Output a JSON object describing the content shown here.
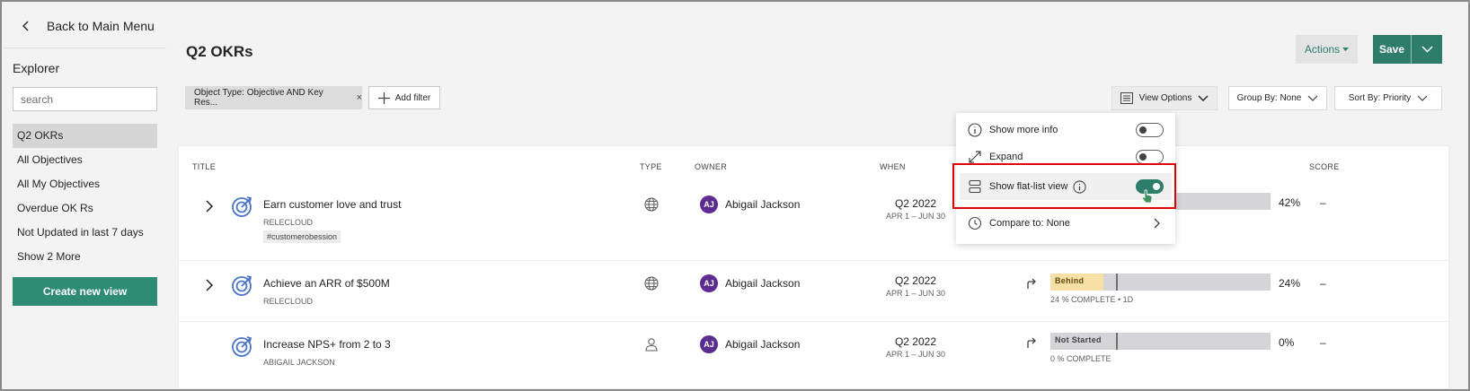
{
  "sidebar": {
    "back_label": "Back to Main Menu",
    "explorer_title": "Explorer",
    "search_placeholder": "search",
    "items": [
      {
        "label": "Q2 OKRs",
        "active": true
      },
      {
        "label": "All Objectives",
        "active": false
      },
      {
        "label": "All My Objectives",
        "active": false
      },
      {
        "label": "Overdue OK Rs",
        "active": false
      },
      {
        "label": "Not Updated in last 7 days",
        "active": false
      },
      {
        "label": "Show 2 More",
        "active": false
      }
    ],
    "create_view_label": "Create new view"
  },
  "header": {
    "title": "Q2 OKRs",
    "actions_label": "Actions",
    "save_label": "Save"
  },
  "filters": {
    "chip_label": "Object Type: Objective AND Key Res...",
    "chip_close": "×",
    "add_filter_label": "Add filter"
  },
  "controls": {
    "view_options": "View Options",
    "group_by": "Group By: None",
    "sort_by": "Sort By: Priority"
  },
  "table": {
    "headers": {
      "title": "TITLE",
      "type": "TYPE",
      "owner": "OWNER",
      "when": "WHEN",
      "score": "SCORE"
    },
    "rows": [
      {
        "title": "Earn customer love and trust",
        "subtitle": "RELECLOUD",
        "tag": "#customerobession",
        "type_icon": "globe-icon",
        "owner_initials": "AJ",
        "owner": "Abigail Jackson",
        "quarter": "Q2 2022",
        "range": "APR 1 – JUN 30",
        "progress": 0.42,
        "percent": "42%",
        "score": "–"
      },
      {
        "title": "Achieve an ARR of $500M",
        "subtitle": "RELECLOUD",
        "type_icon": "globe-icon",
        "owner_initials": "AJ",
        "owner": "Abigail Jackson",
        "quarter": "Q2 2022",
        "range": "APR 1 – JUN 30",
        "status": "Behind",
        "status_color": "#f6e0a6",
        "progress": 0.24,
        "note": "24 % COMPLETE • 1D",
        "percent": "24%",
        "score": "–"
      },
      {
        "title": "Increase NPS+ from 2 to 3",
        "subtitle": "ABIGAIL JACKSON",
        "type_icon": "person-icon",
        "owner_initials": "AJ",
        "owner": "Abigail Jackson",
        "quarter": "Q2 2022",
        "range": "APR 1 – JUN 30",
        "status": "Not Started",
        "status_color": "#d4d4d9",
        "progress": 0.0,
        "note": "0 % COMPLETE",
        "percent": "0%",
        "score": "–"
      }
    ]
  },
  "view_options_menu": {
    "show_more_info": {
      "label": "Show more info",
      "on": false
    },
    "expand": {
      "label": "Expand",
      "on": false
    },
    "flat_list": {
      "label": "Show flat-list view",
      "on": true
    },
    "compare_to": "Compare to: None"
  },
  "colors": {
    "brand": "#2e7d6a",
    "highlight": "#e00000",
    "avatar": "#5c2d91"
  }
}
